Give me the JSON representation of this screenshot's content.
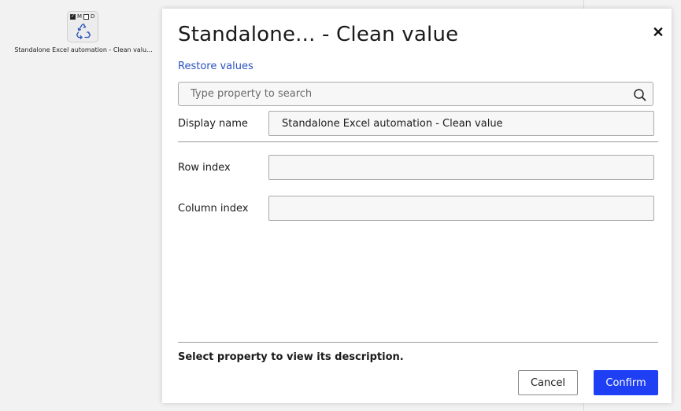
{
  "canvas": {
    "node": {
      "flags": [
        {
          "label": "",
          "checked": true
        },
        {
          "label": "M",
          "checked": false
        },
        {
          "label": "",
          "checked": false
        },
        {
          "label": "D",
          "checked": false
        }
      ],
      "icon": "recycle-icon",
      "label": "Standalone Excel automation - Clean valu..."
    }
  },
  "dialog": {
    "title": "Standalone... - Clean value",
    "close_icon": "close-icon",
    "restore_label": "Restore values",
    "search": {
      "placeholder": "Type property to search",
      "value": "",
      "icon": "search-icon"
    },
    "properties": [
      {
        "label": "Display name",
        "value": "Standalone Excel automation - Clean value"
      },
      {
        "label": "Row index",
        "value": ""
      },
      {
        "label": "Column index",
        "value": ""
      }
    ],
    "description": "Select property to view its description.",
    "cancel_label": "Cancel",
    "confirm_label": "Confirm"
  },
  "colors": {
    "accent": "#1f3ff5",
    "link": "#2a52be",
    "icon": "#2a52be"
  }
}
